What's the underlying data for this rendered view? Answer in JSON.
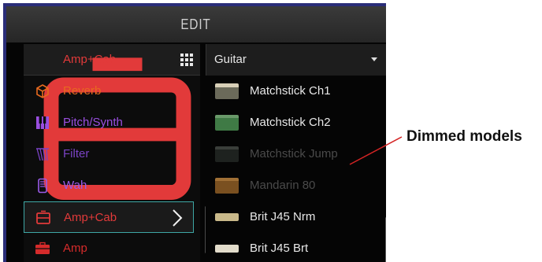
{
  "window": {
    "title": "EDIT"
  },
  "categories": {
    "header": {
      "label": "Amp+Cab",
      "color": "#e23a3a",
      "icon": "amp-cab-icon"
    },
    "items": [
      {
        "label": "Reverb",
        "color": "#e86a1f",
        "icon": "cube-icon"
      },
      {
        "label": "Pitch/Synth",
        "color": "#9a4fe0",
        "icon": "piano-icon"
      },
      {
        "label": "Filter",
        "color": "#7a43c4",
        "icon": "filter-icon"
      },
      {
        "label": "Wah",
        "color": "#9a5be8",
        "icon": "wah-pedal-icon"
      },
      {
        "label": "Amp+Cab",
        "color": "#e23a3a",
        "icon": "amp-cab-icon",
        "selected": true
      },
      {
        "label": "Amp",
        "color": "#d62b2b",
        "icon": "amp-icon"
      }
    ]
  },
  "models": {
    "dropdown": {
      "label": "Guitar"
    },
    "items": [
      {
        "label": "Matchstick Ch1",
        "dimmed": false,
        "thumb_color": "#6b6a5a"
      },
      {
        "label": "Matchstick Ch2",
        "dimmed": false,
        "thumb_color": "#3f7a45"
      },
      {
        "label": "Matchstick Jump",
        "dimmed": true,
        "thumb_color": "#2a2e2a"
      },
      {
        "label": "Mandarin 80",
        "dimmed": true,
        "thumb_color": "#a06a2a"
      },
      {
        "label": "Brit J45 Nrm",
        "dimmed": false,
        "thumb_color": "#c9b98a"
      },
      {
        "label": "Brit J45 Brt",
        "dimmed": false,
        "thumb_color": "#e2dccb"
      }
    ]
  },
  "annotation": {
    "label": "Dimmed models",
    "color": "#d42424"
  }
}
